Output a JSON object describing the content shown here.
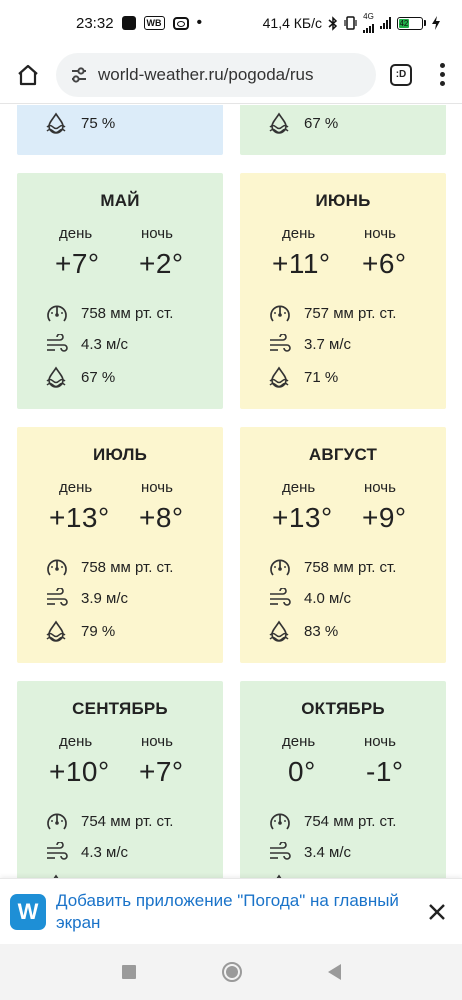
{
  "status_bar": {
    "time": "23:32",
    "wb_label": "WB",
    "net_speed": "41,4 КБ/с",
    "network_type": "4G",
    "battery_level": "42"
  },
  "browser": {
    "url": "world-weather.ru/pogoda/rus",
    "tab_label": ":D"
  },
  "labels": {
    "day": "день",
    "night": "ночь"
  },
  "cards": [
    {
      "month": "",
      "day_temp": "",
      "night_temp": "",
      "pressure": "",
      "wind": "",
      "humidity": "75 %",
      "color": "#dcecf9"
    },
    {
      "month": "",
      "day_temp": "",
      "night_temp": "",
      "pressure": "",
      "wind": "",
      "humidity": "67 %",
      "color": "#dff2dd"
    },
    {
      "month": "МАЙ",
      "day_temp": "+7°",
      "night_temp": "+2°",
      "pressure": "758 мм рт. ст.",
      "wind": "4.3 м/с",
      "humidity": "67 %",
      "color": "#dff2dd"
    },
    {
      "month": "ИЮНЬ",
      "day_temp": "+11°",
      "night_temp": "+6°",
      "pressure": "757 мм рт. ст.",
      "wind": "3.7 м/с",
      "humidity": "71 %",
      "color": "#fcf6cf"
    },
    {
      "month": "ИЮЛЬ",
      "day_temp": "+13°",
      "night_temp": "+8°",
      "pressure": "758 мм рт. ст.",
      "wind": "3.9 м/с",
      "humidity": "79 %",
      "color": "#fcf6cf"
    },
    {
      "month": "АВГУСТ",
      "day_temp": "+13°",
      "night_temp": "+9°",
      "pressure": "758 мм рт. ст.",
      "wind": "4.0 м/с",
      "humidity": "83 %",
      "color": "#fcf6cf"
    },
    {
      "month": "СЕНТЯБРЬ",
      "day_temp": "+10°",
      "night_temp": "+7°",
      "pressure": "754 мм рт. ст.",
      "wind": "4.3 м/с",
      "humidity": "",
      "color": "#dff2dd"
    },
    {
      "month": "ОКТЯБРЬ",
      "day_temp": "0°",
      "night_temp": "-1°",
      "pressure": "754 мм рт. ст.",
      "wind": "3.4 м/с",
      "humidity": "",
      "color": "#dff2dd"
    }
  ],
  "banner": {
    "logo_letter": "W",
    "text": "Добавить приложение \"Погода\" на главный экран"
  },
  "icons": {
    "pressure": "gauge-icon",
    "wind": "wind-icon",
    "humidity": "humidity-icon",
    "home": "home-icon",
    "tune": "site-settings-icon",
    "menu": "more-vert-icon",
    "close": "close-icon"
  }
}
